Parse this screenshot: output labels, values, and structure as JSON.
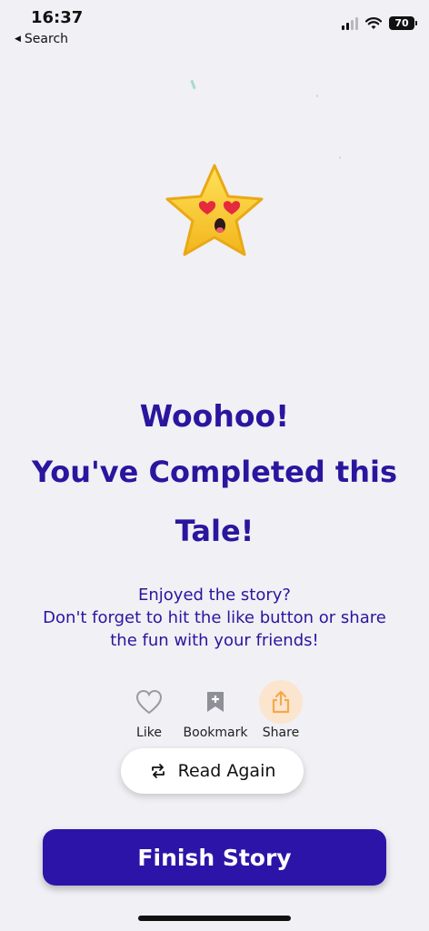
{
  "status_bar": {
    "time": "16:37",
    "back_label": "Search",
    "battery": "70"
  },
  "completion": {
    "title_line1": "Woohoo!",
    "title_line2": "You've Completed this",
    "title_line3": "Tale!",
    "subtitle_line1": "Enjoyed the story?",
    "subtitle_line2": "Don't forget to hit the like button or share",
    "subtitle_line3": "the fun with your friends!",
    "icon": "star-heart-eyes-icon"
  },
  "actions": [
    {
      "label": "Like",
      "icon": "heart-icon"
    },
    {
      "label": "Bookmark",
      "icon": "bookmark-plus-icon"
    },
    {
      "label": "Share",
      "icon": "share-icon"
    }
  ],
  "buttons": {
    "read_again": "Read Again",
    "finish": "Finish Story"
  },
  "colors": {
    "accent": "#2a169e",
    "primary_button": "#2d14a8",
    "share_highlight": "#fbe5cf",
    "share_icon": "#f5a94a",
    "background": "#f1f0f5"
  }
}
